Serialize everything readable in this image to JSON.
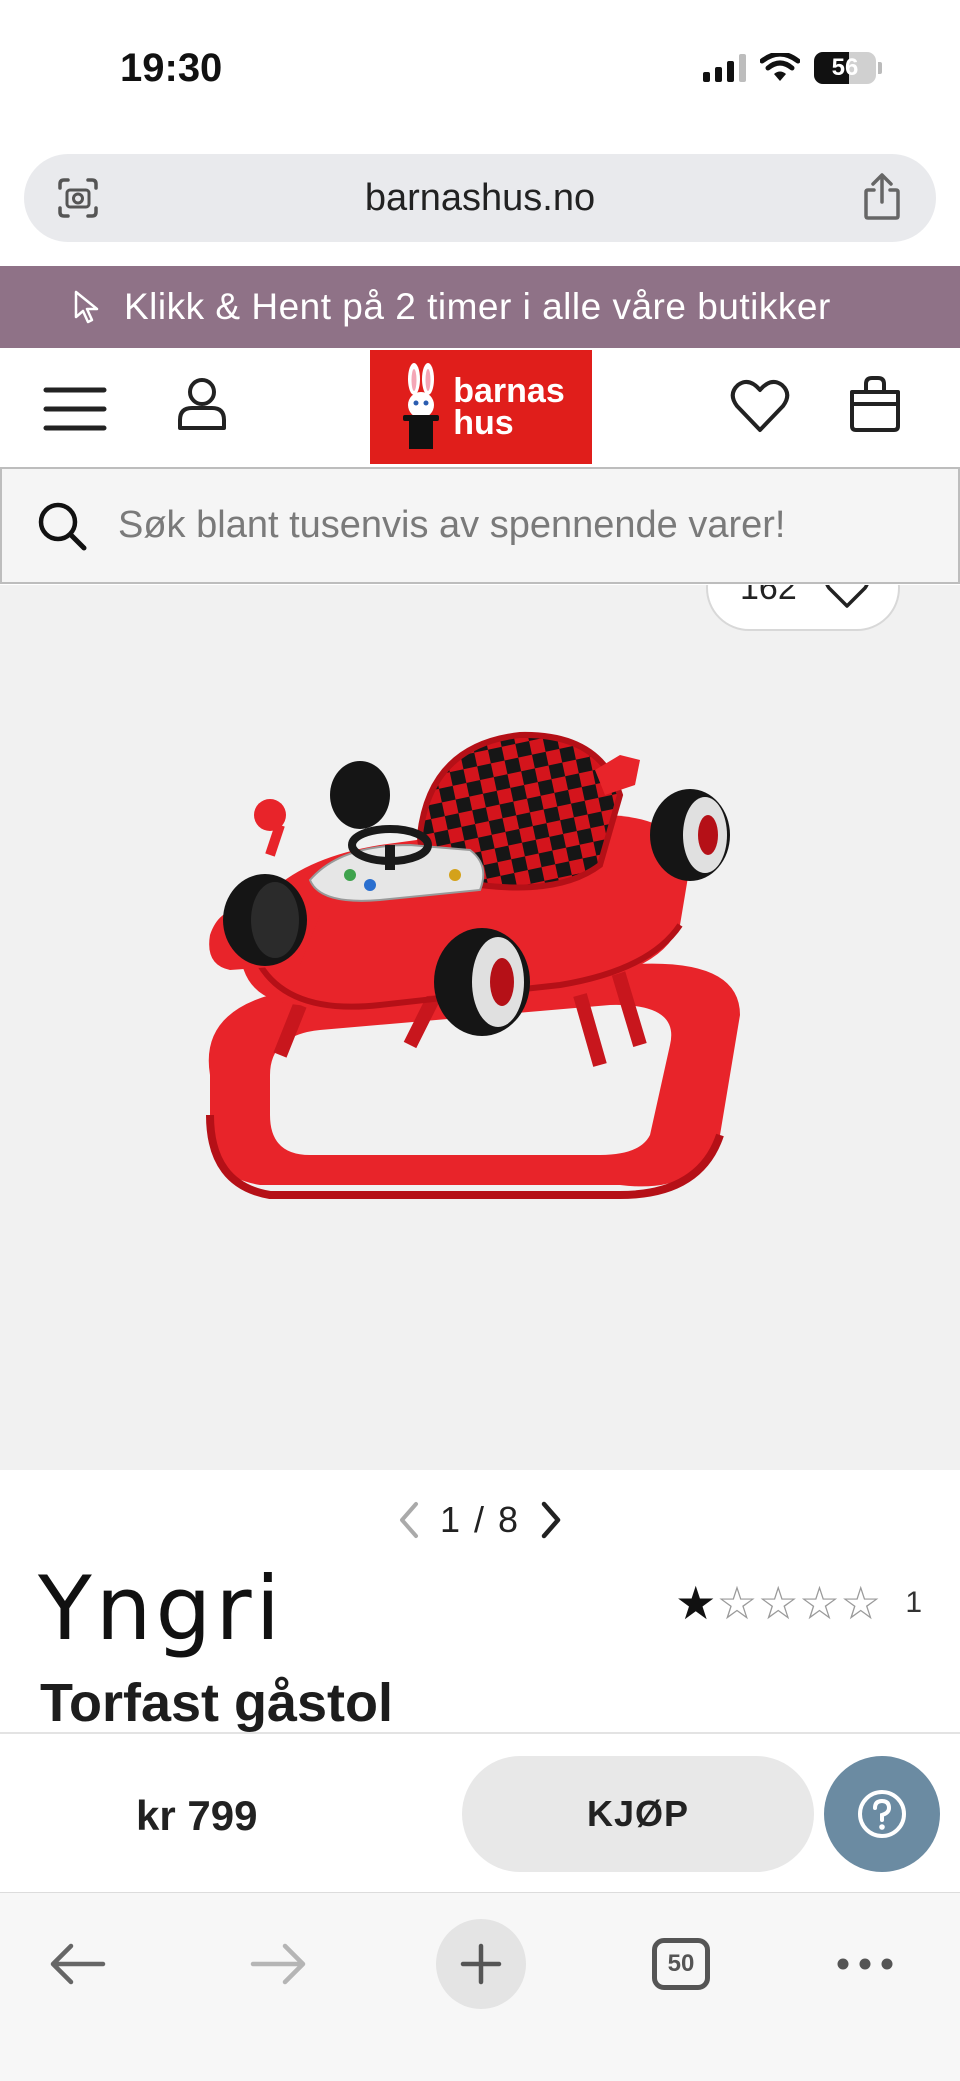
{
  "status_bar": {
    "time": "19:30",
    "battery": "56",
    "battery_level_percent": 56
  },
  "browser": {
    "url": "barnashus.no"
  },
  "promo": {
    "text": "Klikk & Hent på 2 timer i alle våre butikker"
  },
  "header": {
    "logo_line1": "barnas",
    "logo_line2": "hus"
  },
  "search": {
    "placeholder": "Søk blant tusenvis av spennende varer!"
  },
  "product": {
    "favorite_count": "162",
    "image_pager": "1 / 8",
    "brand": "Yngri",
    "title": "Torfast gåstol",
    "rating_stars": 1,
    "rating_max": 5,
    "rating_count": "1",
    "price": "kr 799",
    "buy_label": "KJØP"
  },
  "toolbar": {
    "tab_count": "50"
  },
  "colors": {
    "promo_bg": "#8f7287",
    "logo_red": "#e01e1b",
    "help_button": "#6b8ba2",
    "product_red": "#e8242a"
  }
}
